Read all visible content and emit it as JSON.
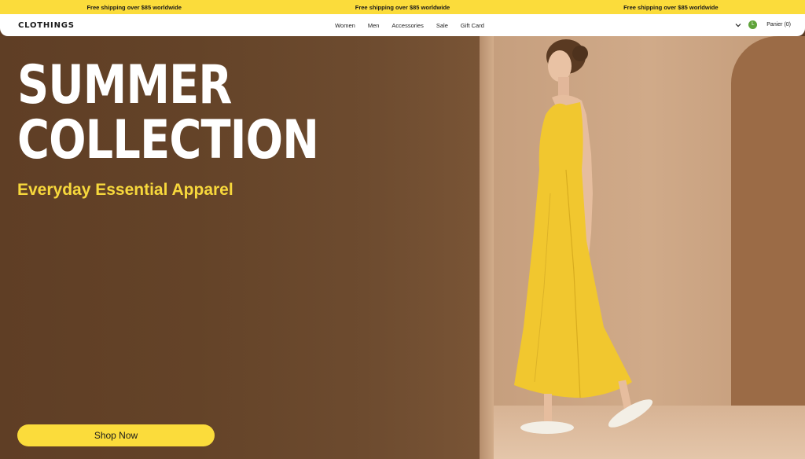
{
  "announcement": {
    "items": [
      "Free shipping over $85 worldwide",
      "Free shipping over $85 worldwide",
      "Free shipping over $85 worldwide"
    ],
    "background": "#fbdc3b"
  },
  "header": {
    "logo": "CLOTHINGS",
    "nav": [
      "Women",
      "Men",
      "Accessories",
      "Sale",
      "Gift Card"
    ],
    "chevron_icon": "chevron-down-icon",
    "avatar_letter": "L",
    "avatar_color": "#5fa33a",
    "cart_label": "Panier (0)"
  },
  "hero": {
    "title_line1": "SUMMER",
    "title_line2": "COLLECTION",
    "subtitle": "Everyday Essential Apparel",
    "subtitle_color": "#f7d83c",
    "cta_label": "Shop Now",
    "cta_color": "#fbdc3b"
  }
}
